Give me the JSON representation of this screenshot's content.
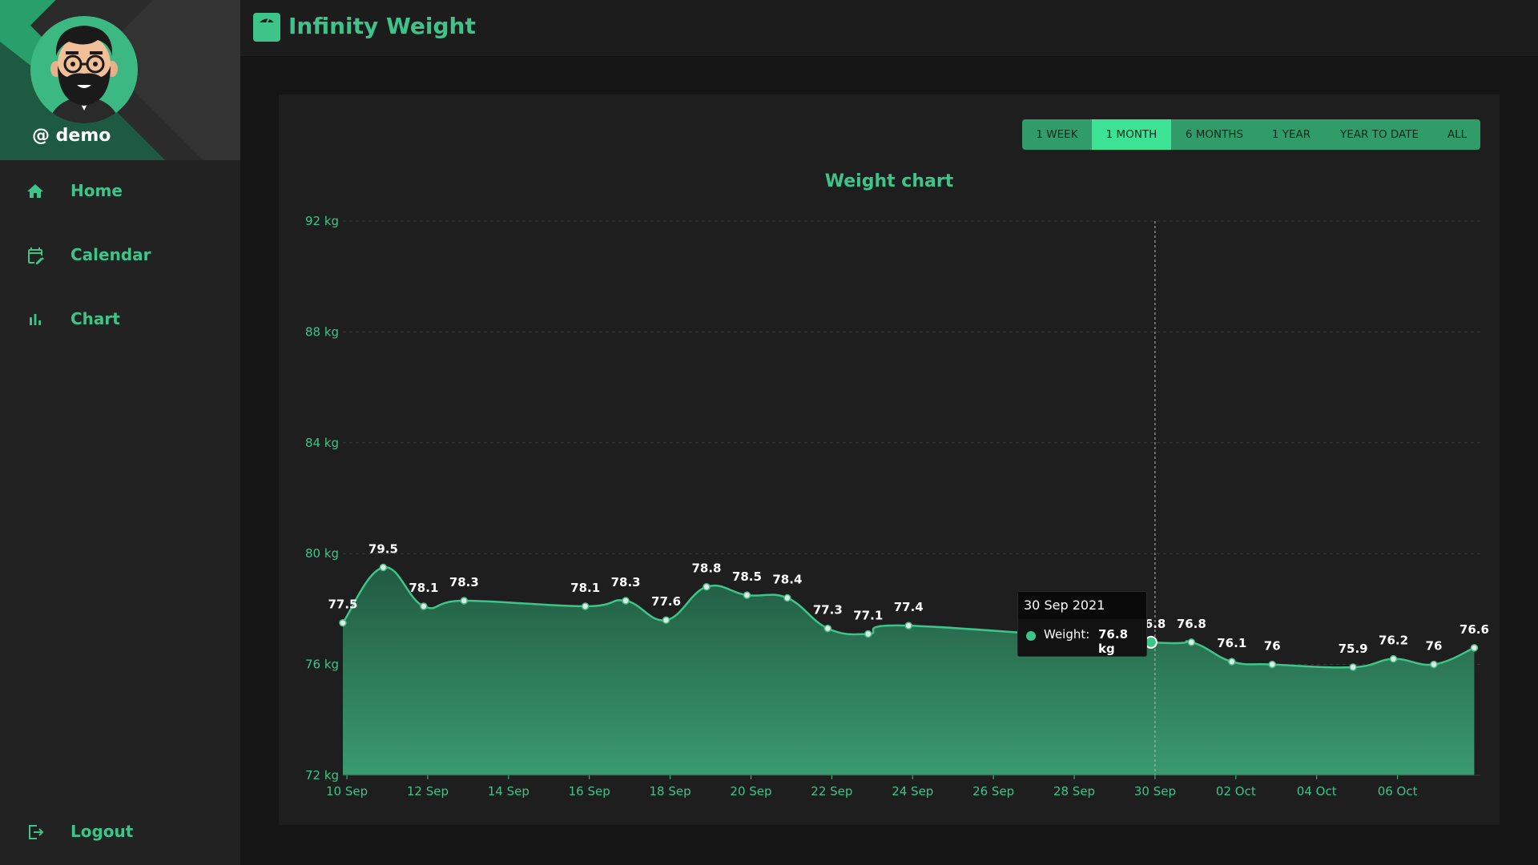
{
  "app": {
    "title": "Infinity Weight"
  },
  "user": {
    "username": "@ demo"
  },
  "sidebar": {
    "items": [
      {
        "label": "Home",
        "icon": "home-icon"
      },
      {
        "label": "Calendar",
        "icon": "calendar-edit-icon"
      },
      {
        "label": "Chart",
        "icon": "bar-chart-icon"
      },
      {
        "label": "Logout",
        "icon": "logout-icon"
      }
    ]
  },
  "ranges": {
    "items": [
      "1 WEEK",
      "1 MONTH",
      "6 MONTHS",
      "1 YEAR",
      "YEAR TO DATE",
      "ALL"
    ],
    "active": "1 MONTH"
  },
  "colors": {
    "accent": "#3ec488",
    "active_button": "#3ce394",
    "button_group": "#2f9c69",
    "background": "#151515",
    "panel": "#1e1e1e"
  },
  "tooltip": {
    "date": "30 Sep 2021",
    "label": "Weight:",
    "value": "76.8 kg"
  },
  "chart_data": {
    "type": "area",
    "title": "Weight chart",
    "y_ticks": [
      "92 kg",
      "88 kg",
      "84 kg",
      "80 kg",
      "76 kg",
      "72 kg"
    ],
    "ylim": [
      72,
      92
    ],
    "x_ticks": [
      "10 Sep",
      "12 Sep",
      "14 Sep",
      "16 Sep",
      "18 Sep",
      "20 Sep",
      "22 Sep",
      "24 Sep",
      "26 Sep",
      "28 Sep",
      "30 Sep",
      "02 Oct",
      "04 Oct",
      "06 Oct"
    ],
    "x_tick_days": [
      0,
      2,
      4,
      6,
      8,
      10,
      12,
      14,
      16,
      18,
      20,
      22,
      24,
      26
    ],
    "xlim": [
      -0.1,
      28.05
    ],
    "grid": true,
    "highlight_day": 20,
    "series": [
      {
        "x": [
          -0.1,
          0.9,
          1.9,
          2.9,
          5.9,
          6.9,
          7.9,
          8.9,
          9.9,
          10.9,
          11.9,
          12.9,
          13.9,
          19.9,
          20.9,
          21.9,
          22.9,
          24.9,
          25.9,
          26.9,
          27.9
        ],
        "values": [
          77.5,
          79.5,
          78.1,
          78.3,
          78.1,
          78.3,
          77.6,
          78.8,
          78.5,
          78.4,
          77.3,
          77.1,
          77.4,
          76.8,
          76.8,
          76.1,
          76,
          75.9,
          76.2,
          76,
          76.6
        ],
        "labels": [
          "77.5",
          "79.5",
          "78.1",
          "78.3",
          "78.1",
          "78.3",
          "77.6",
          "78.8",
          "78.5",
          "78.4",
          "77.3",
          "77.1",
          "77.4",
          "76.8",
          "76.8",
          "76.1",
          "76",
          "75.9",
          "76.2",
          "76",
          "76.6"
        ]
      }
    ]
  }
}
